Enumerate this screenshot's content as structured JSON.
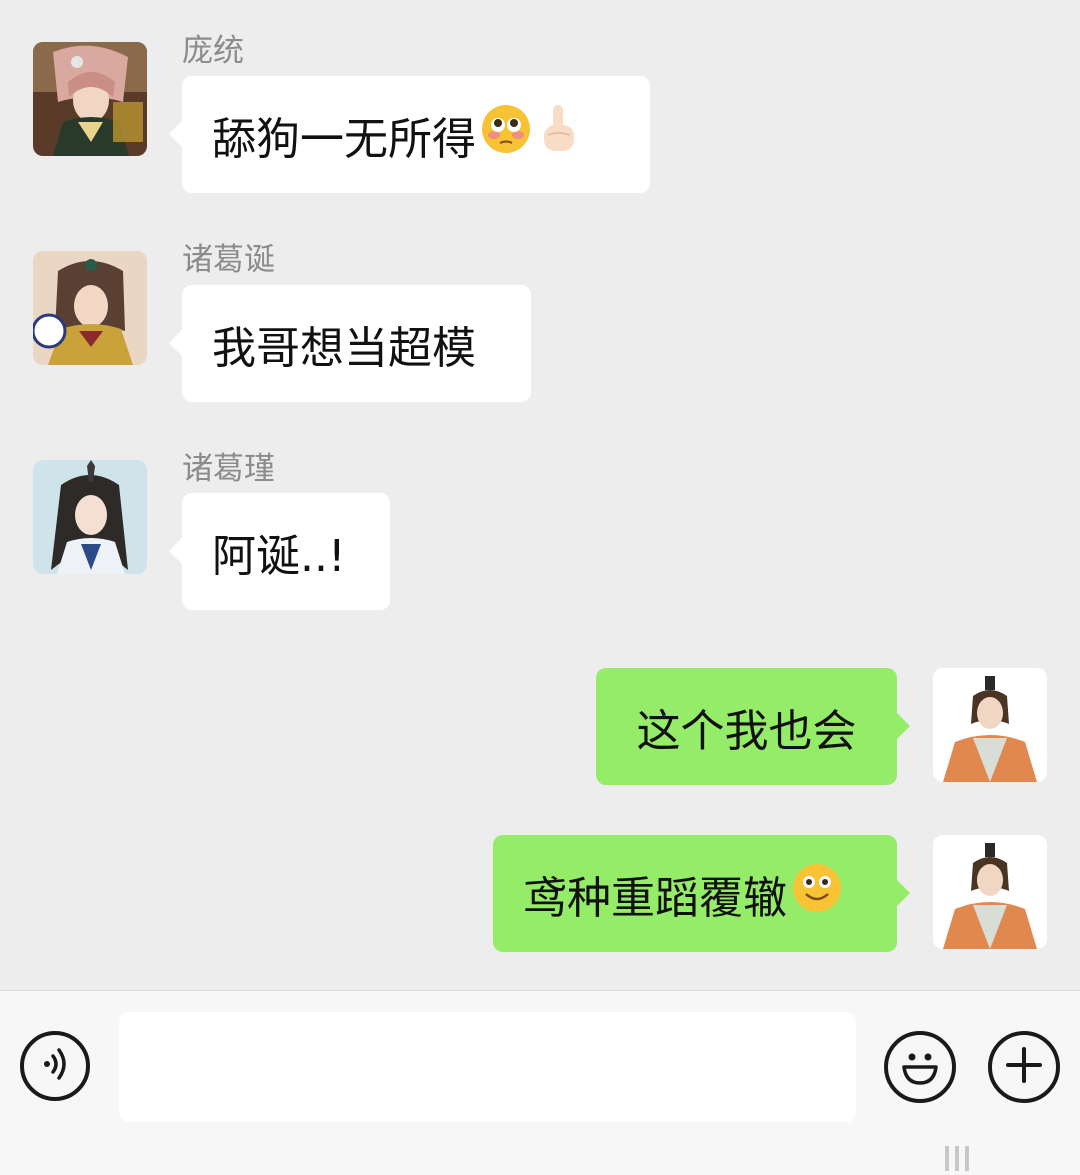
{
  "messages": [
    {
      "sender": "庞统",
      "text": "舔狗一无所得",
      "emojis": [
        "flushed-face",
        "pointing-up-hand"
      ],
      "direction": "incoming",
      "avatar": "pangtong-avatar"
    },
    {
      "sender": "诸葛诞",
      "text": "我哥想当超模",
      "emojis": [],
      "direction": "incoming",
      "avatar": "zhugedan-avatar"
    },
    {
      "sender": "诸葛瑾",
      "text": "阿诞..!",
      "emojis": [],
      "direction": "incoming",
      "avatar": "zhugejin-avatar"
    },
    {
      "sender": "",
      "text": "这个我也会",
      "emojis": [],
      "direction": "outgoing",
      "avatar": "self-avatar"
    },
    {
      "sender": "",
      "text": "鸢种重蹈覆辙",
      "emojis": [
        "smiling-face"
      ],
      "direction": "outgoing",
      "avatar": "self-avatar"
    }
  ],
  "input_bar": {
    "voice_icon": "voice-input-icon",
    "text_value": "",
    "emoji_icon": "emoji-smile-icon",
    "add_icon": "plus-icon"
  },
  "colors": {
    "background": "#ededed",
    "incoming_bubble": "#ffffff",
    "outgoing_bubble": "#95ec69",
    "sender_text": "#8c8c8c"
  }
}
